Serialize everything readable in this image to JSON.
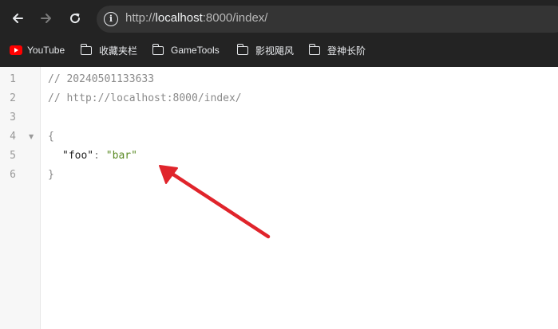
{
  "browser": {
    "url_scheme": "http://",
    "url_host": "localhost",
    "url_rest": ":8000/index/",
    "bookmarks": [
      {
        "label": "YouTube",
        "icon": "youtube-icon"
      },
      {
        "label": "收藏夹栏",
        "icon": "folder-icon"
      },
      {
        "label": "GameTools",
        "icon": "folder-icon"
      },
      {
        "label": "影视飓风",
        "icon": "folder-icon"
      },
      {
        "label": "登神长阶",
        "icon": "folder-icon"
      }
    ]
  },
  "editor": {
    "line_numbers": [
      "1",
      "2",
      "3",
      "4",
      "5",
      "6"
    ],
    "comment_1": "// 20240501133633",
    "comment_2": "// http://localhost:8000/index/",
    "open_brace": "{",
    "key": "\"foo\"",
    "colon": ": ",
    "value": "\"bar\"",
    "close_brace": "}"
  },
  "annotation": {
    "arrow_color": "#e0242b"
  }
}
